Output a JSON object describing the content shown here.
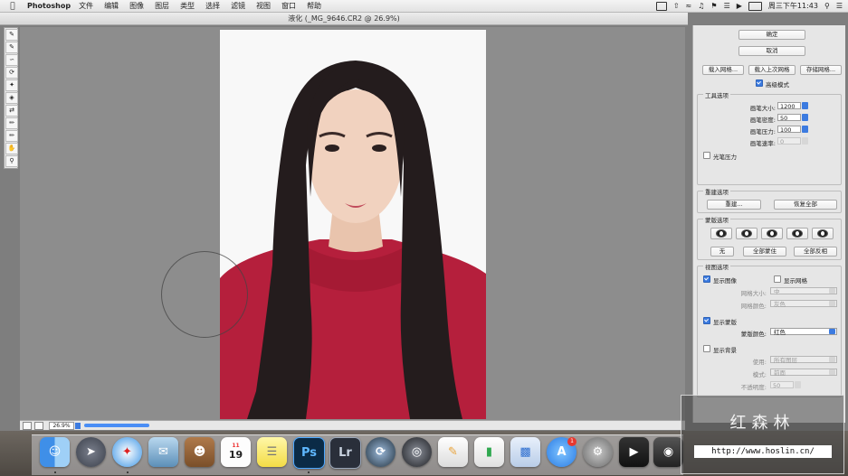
{
  "menubar": {
    "app_name": "Photoshop",
    "items": [
      "文件",
      "编辑",
      "图像",
      "图层",
      "类型",
      "选择",
      "滤镜",
      "视图",
      "窗口",
      "帮助"
    ],
    "clock": "周三下午11:43"
  },
  "window": {
    "title": "液化 (_MG_9646.CR2 @ 26.9%)"
  },
  "tools": [
    "wrap-forward",
    "reconstruct",
    "smooth",
    "twirl",
    "pucker",
    "bloat",
    "push-left",
    "freeze-mask",
    "thaw-mask",
    "hand",
    "zoom"
  ],
  "status": {
    "zoom": "26.9%"
  },
  "panel": {
    "ok_label": "确定",
    "cancel_label": "取消",
    "load_mesh_label": "载入网格...",
    "load_last_mesh_label": "载入上次网格",
    "save_mesh_label": "存储网格...",
    "advanced_mode_label": "高级模式",
    "tool_options": {
      "title": "工具选项",
      "brush_size_label": "画笔大小:",
      "brush_size_value": "1200",
      "brush_density_label": "画笔密度:",
      "brush_density_value": "50",
      "brush_pressure_label": "画笔压力:",
      "brush_pressure_value": "100",
      "brush_rate_label": "画笔速率:",
      "brush_rate_value": "0",
      "stylus_label": "光笔压力"
    },
    "reconstruct_options": {
      "title": "重建选项",
      "reconstruct_label": "重建...",
      "restore_all_label": "恢复全部"
    },
    "mask_options": {
      "title": "蒙版选项",
      "none_label": "无",
      "mask_all_label": "全部蒙住",
      "invert_all_label": "全部反相"
    },
    "view_options": {
      "title": "视图选项",
      "show_image_label": "显示图像",
      "show_mesh_label": "显示网格",
      "mesh_size_label": "网格大小:",
      "mesh_size_value": "中",
      "mesh_color_label": "网格颜色:",
      "mesh_color_value": "灰色",
      "show_mask_label": "显示蒙版",
      "mask_color_label": "蒙版颜色:",
      "mask_color_value": "红色",
      "show_backdrop_label": "显示背景",
      "use_label": "使用:",
      "use_value": "所有图层",
      "mode_label": "模式:",
      "mode_value": "前面",
      "opacity_label": "不透明度:",
      "opacity_value": "50"
    }
  },
  "dock": {
    "calendar_day": "11",
    "calendar_date": "19",
    "ps_label": "Ps",
    "lr_label": "Lr",
    "appstore_badge": "1",
    "colors": {
      "ps": "#0b2b46",
      "lr": "#2a2f3a",
      "accent": "#3c7be0"
    }
  },
  "watermark": {
    "title": "红森林",
    "url": "http://www.hoslin.cn/"
  }
}
